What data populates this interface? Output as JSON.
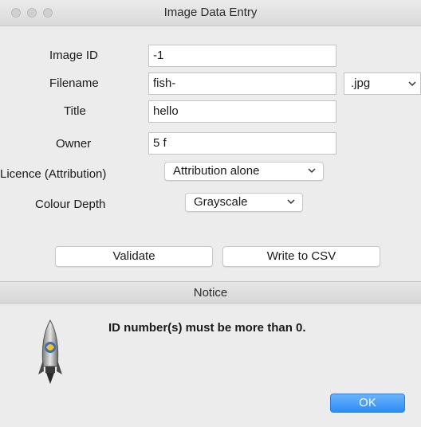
{
  "window": {
    "title": "Image Data Entry"
  },
  "form": {
    "image_id": {
      "label": "Image ID",
      "value": "-1"
    },
    "filename": {
      "label": "Filename",
      "value": "fish-",
      "extension": ".jpg"
    },
    "title": {
      "label": "Title",
      "value": "hello"
    },
    "owner": {
      "label": "Owner",
      "value": "5 f"
    },
    "licence": {
      "label": "Licence (Attribution)",
      "selected": "Attribution alone"
    },
    "colour_depth": {
      "label": "Colour Depth",
      "selected": "Grayscale"
    }
  },
  "buttons": {
    "validate": "Validate",
    "write_csv": "Write to CSV"
  },
  "notice": {
    "title": "Notice",
    "message": "ID number(s) must be more than 0.",
    "ok_label": "OK",
    "icon": "python-launcher-rocket-icon"
  },
  "colors": {
    "accent": "#2c8df4",
    "window_bg": "#ececec"
  }
}
